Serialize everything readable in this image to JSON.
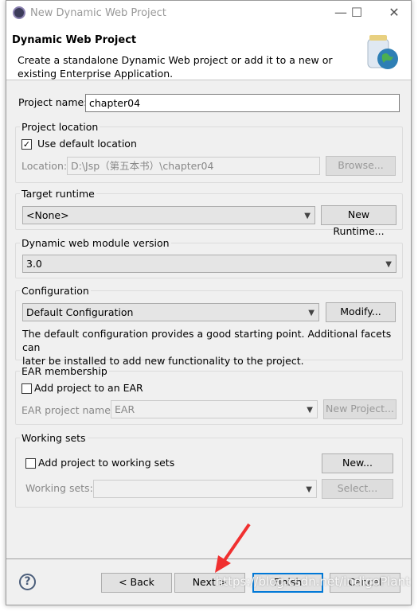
{
  "window": {
    "title": "New Dynamic Web Project"
  },
  "header": {
    "title": "Dynamic Web Project",
    "desc1": "Create a standalone Dynamic Web project or add it to a new or",
    "desc2": "existing Enterprise Application."
  },
  "project_name": {
    "label": "Project name:",
    "value": "chapter04"
  },
  "location": {
    "group": "Project location",
    "use_default": "Use default location",
    "checked": true,
    "label": "Location:",
    "value": "D:\\Jsp（第五本书）\\chapter04",
    "browse": "Browse..."
  },
  "runtime": {
    "group": "Target runtime",
    "value": "<None>",
    "new": "New Runtime..."
  },
  "module": {
    "group": "Dynamic web module version",
    "value": "3.0"
  },
  "config": {
    "group": "Configuration",
    "value": "Default Configuration",
    "modify": "Modify...",
    "desc1": "The default configuration provides a good starting point. Additional facets can",
    "desc2": "later be installed to add new functionality to the project."
  },
  "ear": {
    "group": "EAR membership",
    "add": "Add project to an EAR",
    "checked": false,
    "label": "EAR project name:",
    "value": "EAR",
    "new": "New Project..."
  },
  "ws": {
    "group": "Working sets",
    "add": "Add project to working sets",
    "checked": false,
    "new": "New...",
    "label": "Working sets:",
    "select": "Select..."
  },
  "footer": {
    "back": "< Back",
    "next": "Next >",
    "finish": "Finish",
    "cancel": "Cancel"
  },
  "watermark": "https://blog.csdn.net/indigoPlant",
  "colors": {
    "accent": "#0078d7",
    "arrow": "#f03030"
  }
}
